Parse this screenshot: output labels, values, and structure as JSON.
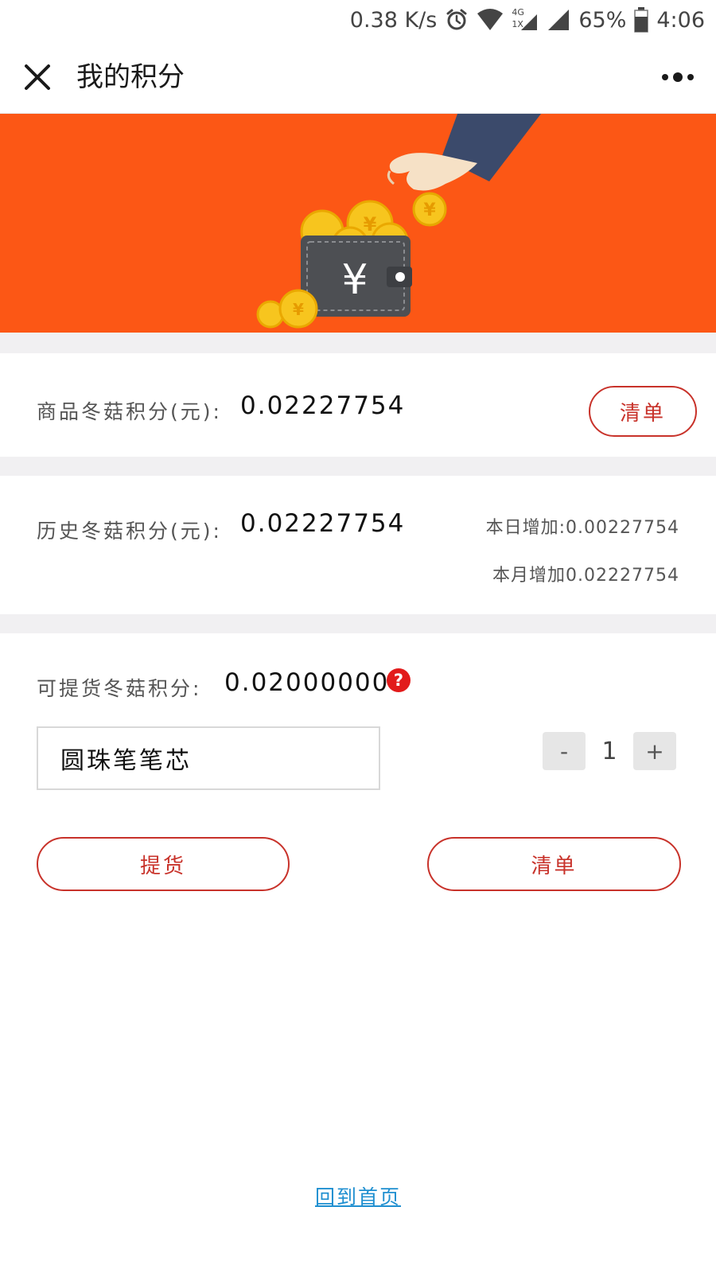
{
  "status_bar": {
    "net_speed": "0.38 K/s",
    "network_top": "4G",
    "network_bottom": "1X",
    "battery": "65%",
    "time": "4:06",
    "icons": [
      "alarm-icon",
      "wifi-icon",
      "signal-icon",
      "signal-icon",
      "battery-icon"
    ]
  },
  "title_bar": {
    "title": "我的积分",
    "close_icon": "close-icon",
    "more_icon": "more-icon"
  },
  "banner": {
    "wallet_symbol": "¥",
    "coin_symbol": "¥",
    "colors": {
      "background": "#fc5715",
      "coin": "#f7c51e",
      "wallet": "#4d4f53",
      "sleeve": "#3b4a6b"
    }
  },
  "goods_points": {
    "label": "商品冬菇积分(元):",
    "value": "0.02227754",
    "button": "清单"
  },
  "history_points": {
    "label": "历史冬菇积分(元):",
    "value": "0.02227754",
    "today": "本日增加:0.00227754",
    "month": "本月增加0.02227754"
  },
  "pickup": {
    "label": "可提货冬菇积分:",
    "value": "0.02000000",
    "help_icon": "?",
    "item_name": "圆珠笔笔芯",
    "quantity_minus": "-",
    "quantity": "1",
    "quantity_plus": "+",
    "pickup_button": "提货",
    "list_button": "清单"
  },
  "footer": {
    "home_link": "回到首页"
  },
  "colors": {
    "accent": "#c8322a",
    "link": "#1f8fd0",
    "separator": "#f1f0f2",
    "help_badge": "#e21b1b"
  }
}
